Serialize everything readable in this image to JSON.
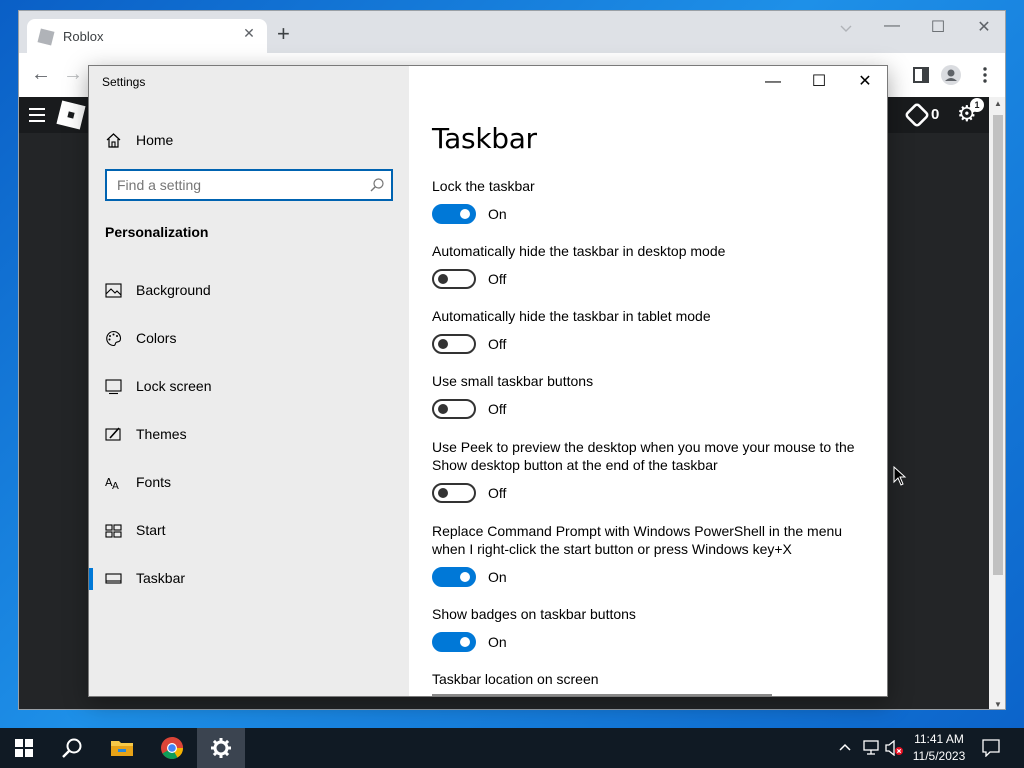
{
  "browser": {
    "tab_title": "Roblox",
    "tab_close": "✕",
    "new_tab": "+",
    "minimize": "—",
    "maximize": "☐",
    "close": "✕",
    "back": "←",
    "forward": "→",
    "roblox_robux_count": "0",
    "roblox_badge": "1"
  },
  "settings_window": {
    "title": "Settings",
    "controls": {
      "minimize": "—",
      "maximize": "☐",
      "close": "✕"
    },
    "sidebar": {
      "home_label": "Home",
      "search_placeholder": "Find a setting",
      "section_title": "Personalization",
      "items": [
        {
          "label": "Background",
          "icon": "picture-icon"
        },
        {
          "label": "Colors",
          "icon": "palette-icon"
        },
        {
          "label": "Lock screen",
          "icon": "lock-screen-icon"
        },
        {
          "label": "Themes",
          "icon": "themes-icon"
        },
        {
          "label": "Fonts",
          "icon": "fonts-icon"
        },
        {
          "label": "Start",
          "icon": "start-icon"
        },
        {
          "label": "Taskbar",
          "icon": "taskbar-icon",
          "active": true
        }
      ]
    },
    "content": {
      "title": "Taskbar",
      "settings": [
        {
          "label": "Lock the taskbar",
          "state": "On",
          "on": true
        },
        {
          "label": "Automatically hide the taskbar in desktop mode",
          "state": "Off",
          "on": false
        },
        {
          "label": "Automatically hide the taskbar in tablet mode",
          "state": "Off",
          "on": false
        },
        {
          "label": "Use small taskbar buttons",
          "state": "Off",
          "on": false
        },
        {
          "label": "Use Peek to preview the desktop when you move your mouse to the Show desktop button at the end of the taskbar",
          "state": "Off",
          "on": false
        },
        {
          "label": "Replace Command Prompt with Windows PowerShell in the menu when I right-click the start button or press Windows key+X",
          "state": "On",
          "on": true
        },
        {
          "label": "Show badges on taskbar buttons",
          "state": "On",
          "on": true
        }
      ],
      "location_label": "Taskbar location on screen"
    }
  },
  "taskbar": {
    "time": "11:41 AM",
    "date": "11/5/2023",
    "apps": [
      "start-icon",
      "search-icon",
      "file-explorer-icon",
      "chrome-icon",
      "settings-icon"
    ]
  },
  "colors": {
    "accent": "#0078d7",
    "sidebar_bg": "#ececec",
    "taskbar_bg": "#101a24",
    "roblox_bg": "#232527"
  }
}
